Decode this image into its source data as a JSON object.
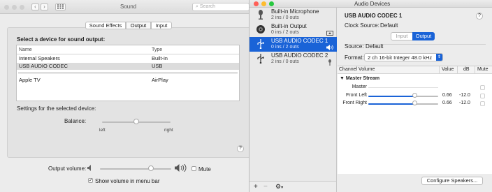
{
  "sound": {
    "title": "Sound",
    "search_placeholder": "Search",
    "tabs": [
      "Sound Effects",
      "Output",
      "Input"
    ],
    "select_heading": "Select a device for sound output:",
    "columns": [
      "Name",
      "Type"
    ],
    "devices": [
      {
        "name": "Internal Speakers",
        "type": "Built-in"
      },
      {
        "name": "USB AUDIO  CODEC",
        "type": "USB"
      },
      {
        "name": "Apple TV",
        "type": "AirPlay"
      }
    ],
    "settings_label": "Settings for the selected device:",
    "balance_label": "Balance:",
    "balance_left": "left",
    "balance_right": "right",
    "balance_value": 0.5,
    "help": "?",
    "output_volume_label": "Output volume:",
    "output_volume_value": 0.72,
    "mute_label": "Mute",
    "menu_bar_label": "Show volume in menu bar",
    "menu_bar_checked": true
  },
  "audio": {
    "title": "Audio Devices",
    "devices": [
      {
        "name": "Built-in Microphone",
        "io": "2 ins / 0 outs",
        "icon": "microphone-icon"
      },
      {
        "name": "Built-in Output",
        "io": "0 ins / 2 outs",
        "icon": "speaker-icon"
      },
      {
        "name": "USB AUDIO  CODEC 1",
        "io": "0 ins / 2 outs",
        "icon": "usb-icon"
      },
      {
        "name": "USB AUDIO  CODEC 2",
        "io": "2 ins / 0 outs",
        "icon": "usb-icon"
      }
    ],
    "selected_device": "USB AUDIO  CODEC 1",
    "clock_source_label": "Clock Source:",
    "clock_source_value": "Default",
    "help": "?",
    "io_tabs": [
      "Input",
      "Output"
    ],
    "source_label": "Source:",
    "source_value": "Default",
    "format_label": "Format:",
    "format_value": "2 ch 16-bit Integer 48.0 kHz",
    "table_columns": [
      "Channel Volume",
      "Value",
      "dB",
      "Mute"
    ],
    "stream_label": "Master Stream",
    "channels": [
      {
        "name": "Master",
        "value": "",
        "db": "",
        "level": null
      },
      {
        "name": "Front Left",
        "value": "0.66",
        "db": "-12.0",
        "level": 0.66
      },
      {
        "name": "Front Right",
        "value": "0.66",
        "db": "-12.0",
        "level": 0.66
      }
    ],
    "add_label": "+",
    "remove_label": "−",
    "configure_label": "Configure Speakers..."
  },
  "colors": {
    "accent": "#1a63d7",
    "selection_gray": "#dcdcdc"
  }
}
